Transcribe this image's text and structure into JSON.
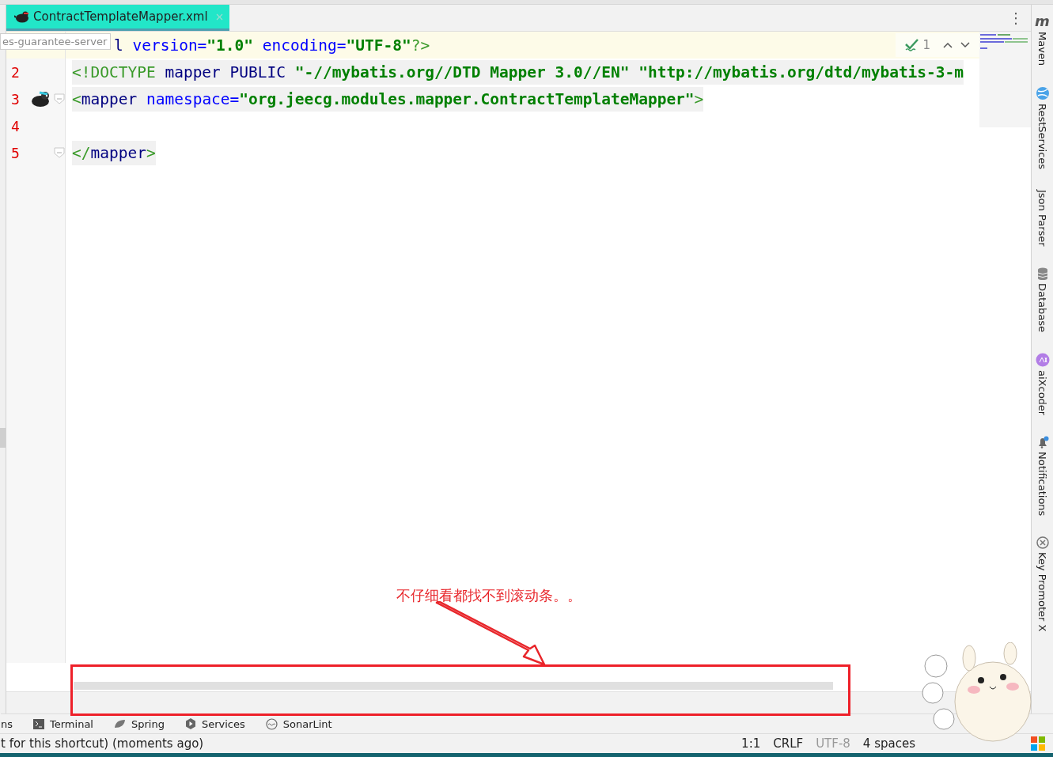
{
  "tab": {
    "label": "ContractTemplateMapper.xml",
    "selected": true
  },
  "tooltip": "es-guarantee-server",
  "more_glyph": "⋮",
  "inspection": {
    "count": "1"
  },
  "lines": [
    {
      "current": true,
      "gutter_icon": false,
      "fold": false,
      "tokens": [
        {
          "kind": "tag",
          "text": "l "
        },
        {
          "kind": "attr",
          "text": "version="
        },
        {
          "kind": "string",
          "text": "\"1.0\" "
        },
        {
          "kind": "attr",
          "text": "encoding="
        },
        {
          "kind": "string",
          "text": "\"UTF-8\""
        },
        {
          "kind": "bracket",
          "text": "?>"
        }
      ]
    },
    {
      "number": "2",
      "current": false,
      "gutter_icon": false,
      "fold": false,
      "tokens": [
        {
          "kind": "bracket",
          "text": "<!DOCTYPE "
        },
        {
          "kind": "tag",
          "text": "mapper PUBLIC "
        },
        {
          "kind": "string",
          "text": "\"-//mybatis.org//DTD Mapper 3.0//EN\" \"http://mybatis.org/dtd/mybatis-3-m"
        }
      ]
    },
    {
      "number": "3",
      "current": false,
      "gutter_icon": true,
      "fold": true,
      "tokens": [
        {
          "kind": "bracket",
          "text": "<"
        },
        {
          "kind": "tag",
          "text": "mapper "
        },
        {
          "kind": "attr",
          "text": "namespace="
        },
        {
          "kind": "string",
          "text": "\"org.jeecg.modules.mapper.ContractTemplateMapper\""
        },
        {
          "kind": "bracket",
          "text": ">"
        }
      ]
    },
    {
      "number": "4",
      "current": false,
      "gutter_icon": false,
      "fold": false
    },
    {
      "number": "5",
      "current": false,
      "gutter_icon": false,
      "fold": true,
      "tokens": [
        {
          "kind": "bracket",
          "text": "</"
        },
        {
          "kind": "tag",
          "text": "mapper"
        },
        {
          "kind": "bracket",
          "text": ">"
        }
      ]
    }
  ],
  "side_tools": [
    {
      "glyph": "m",
      "label": "Maven"
    },
    {
      "label": "RestServices"
    },
    {
      "label": "Json Parser"
    },
    {
      "label": "Database"
    },
    {
      "label": "aiXcoder"
    },
    {
      "label": "Notifications"
    },
    {
      "label": "Key Promoter X"
    }
  ],
  "tool_tabs": [
    {
      "label": "ns"
    },
    {
      "label": "Terminal"
    },
    {
      "label": "Spring"
    },
    {
      "label": "Services"
    },
    {
      "label": "SonarLint"
    }
  ],
  "status_bar": {
    "message": "t for this shortcut) (moments ago)",
    "items": [
      {
        "label": "1:1",
        "disabled": false
      },
      {
        "label": "CRLF",
        "disabled": false
      },
      {
        "label": "UTF-8",
        "disabled": true
      },
      {
        "label": "4 spaces",
        "disabled": false
      }
    ]
  },
  "annotation": {
    "text": "不仔细看都找不到滚动条。。"
  }
}
